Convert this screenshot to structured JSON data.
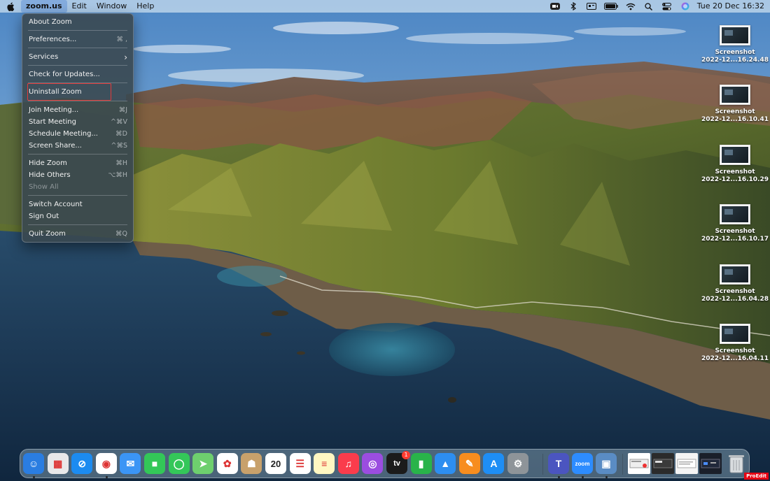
{
  "menubar": {
    "apple_icon": "apple-logo",
    "items": [
      "zoom.us",
      "Edit",
      "Window",
      "Help"
    ],
    "status_icons": [
      "zoom-status-icon",
      "bluetooth-icon",
      "display-icon",
      "battery-icon",
      "wifi-icon",
      "spotlight-search-icon",
      "control-center-icon",
      "siri-icon"
    ],
    "clock": "Tue 20 Dec  16:32"
  },
  "dropdown": {
    "items": [
      {
        "label": "About Zoom",
        "shortcut": ""
      },
      {
        "label": "Preferences...",
        "shortcut": "⌘ ,"
      },
      {
        "label": "Services",
        "shortcut": "›"
      },
      {
        "label": "Check for Updates...",
        "shortcut": ""
      },
      {
        "label": "Uninstall Zoom",
        "shortcut": ""
      },
      {
        "label": "Join Meeting...",
        "shortcut": "⌘J"
      },
      {
        "label": "Start Meeting",
        "shortcut": "^⌘V"
      },
      {
        "label": "Schedule Meeting...",
        "shortcut": "⌘D"
      },
      {
        "label": "Screen Share...",
        "shortcut": "^⌘S"
      },
      {
        "label": "Hide Zoom",
        "shortcut": "⌘H"
      },
      {
        "label": "Hide Others",
        "shortcut": "⌥⌘H"
      },
      {
        "label": "Show All",
        "shortcut": ""
      },
      {
        "label": "Switch Account",
        "shortcut": ""
      },
      {
        "label": "Sign Out",
        "shortcut": ""
      },
      {
        "label": "Quit Zoom",
        "shortcut": "⌘Q"
      }
    ],
    "highlight_color": "#e33a3a"
  },
  "desktop": {
    "files": [
      {
        "name": "Screenshot",
        "detail": "2022-12...16.24.48"
      },
      {
        "name": "Screenshot",
        "detail": "2022-12...16.10.41"
      },
      {
        "name": "Screenshot",
        "detail": "2022-12...16.10.29"
      },
      {
        "name": "Screenshot",
        "detail": "2022-12...16.10.17"
      },
      {
        "name": "Screenshot",
        "detail": "2022-12...16.04.28"
      },
      {
        "name": "Screenshot",
        "detail": "2022-12...16.04.11"
      }
    ]
  },
  "dock": {
    "apps": [
      {
        "name": "Finder",
        "icon": "finder-icon",
        "color": "#2a7de1",
        "glyph": "☺",
        "running": true
      },
      {
        "name": "Launchpad",
        "icon": "launchpad-icon",
        "color": "#e8e8ea",
        "glyph": "▦",
        "running": false
      },
      {
        "name": "Safari",
        "icon": "safari-icon",
        "color": "#1c8bf0",
        "glyph": "⊘",
        "running": false
      },
      {
        "name": "Chrome",
        "icon": "chrome-icon",
        "color": "#ffffff",
        "glyph": "◉",
        "running": true
      },
      {
        "name": "Mail",
        "icon": "mail-icon",
        "color": "#3b95f5",
        "glyph": "✉",
        "running": false
      },
      {
        "name": "FaceTime",
        "icon": "facetime-icon",
        "color": "#33c758",
        "glyph": "■",
        "running": false
      },
      {
        "name": "Messages",
        "icon": "messages-icon",
        "color": "#34c759",
        "glyph": "◯",
        "running": false
      },
      {
        "name": "Maps",
        "icon": "maps-icon",
        "color": "#6ecf6e",
        "glyph": "➤",
        "running": false
      },
      {
        "name": "Photos",
        "icon": "photos-icon",
        "color": "#ffffff",
        "glyph": "✿",
        "running": false
      },
      {
        "name": "Contacts",
        "icon": "contacts-icon",
        "color": "#c8a16b",
        "glyph": "☗",
        "running": false
      },
      {
        "name": "Calendar",
        "icon": "calendar-icon",
        "color": "#ffffff",
        "glyph": "20",
        "running": false
      },
      {
        "name": "Reminders",
        "icon": "reminders-icon",
        "color": "#ffffff",
        "glyph": "☰",
        "running": false
      },
      {
        "name": "Notes",
        "icon": "notes-icon",
        "color": "#fff7c2",
        "glyph": "≡",
        "running": false
      },
      {
        "name": "Music",
        "icon": "music-icon",
        "color": "#fa3c4c",
        "glyph": "♫",
        "running": false
      },
      {
        "name": "Podcasts",
        "icon": "podcasts-icon",
        "color": "#9b4de0",
        "glyph": "◎",
        "running": false
      },
      {
        "name": "TV",
        "icon": "apple-tv-icon",
        "color": "#1b1b1b",
        "glyph": "tv",
        "running": false
      },
      {
        "name": "Numbers",
        "icon": "numbers-icon",
        "color": "#29b34a",
        "glyph": "▮",
        "running": false
      },
      {
        "name": "Keynote",
        "icon": "keynote-icon",
        "color": "#2d8ef0",
        "glyph": "▲",
        "running": false
      },
      {
        "name": "Pages",
        "icon": "pages-icon",
        "color": "#f78d1f",
        "glyph": "✎",
        "running": false
      },
      {
        "name": "App Store",
        "icon": "app-store-icon",
        "color": "#1e8ef5",
        "glyph": "A",
        "running": false
      },
      {
        "name": "System Preferences",
        "icon": "system-preferences-icon",
        "color": "#8e9499",
        "glyph": "⚙",
        "running": false
      },
      {
        "name": "Teams",
        "icon": "teams-icon",
        "color": "#4b55c0",
        "glyph": "T",
        "running": true
      },
      {
        "name": "Zoom",
        "icon": "zoom-icon",
        "color": "#2d8cff",
        "glyph": "zoom",
        "running": true
      },
      {
        "name": "Preview",
        "icon": "preview-icon",
        "color": "#5a8cc4",
        "glyph": "▣",
        "running": true
      }
    ],
    "tv_badge": "1",
    "trash_icon": "trash-icon"
  },
  "watermark": "ProEdit"
}
